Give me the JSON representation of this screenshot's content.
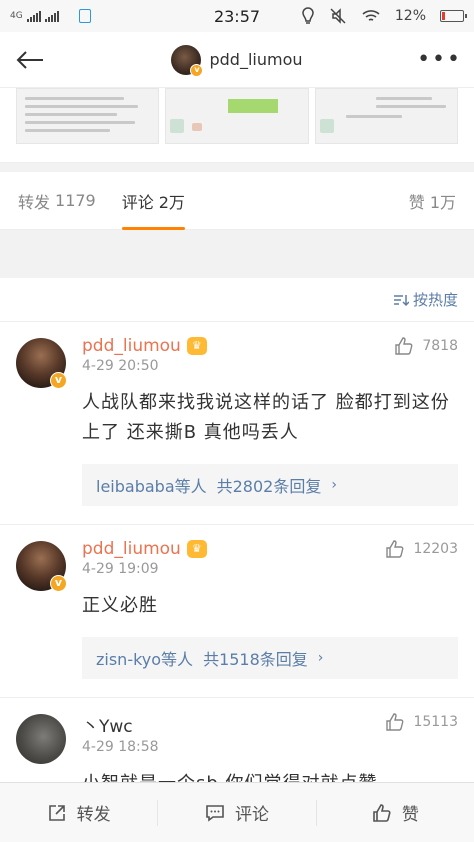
{
  "status_bar": {
    "network": "4G",
    "time": "23:57",
    "battery_percent": "12%"
  },
  "header": {
    "title": "pdd_liumou"
  },
  "tabs": [
    {
      "label": "转发",
      "count": "1179"
    },
    {
      "label": "评论",
      "count": "2万"
    },
    {
      "label": "赞",
      "count": "1万"
    }
  ],
  "sort_label": "按热度",
  "comments": [
    {
      "name": "pdd_liumou",
      "time": "4-29 20:50",
      "likes": "7818",
      "text": "人战队都来找我说这样的话了 脸都打到这份上了 还来撕B 真他吗丢人",
      "replies": {
        "users": "leibababa等人",
        "count": "共2802条回复"
      }
    },
    {
      "name": "pdd_liumou",
      "time": "4-29 19:09",
      "likes": "12203",
      "text": "正义必胜",
      "replies": {
        "users": "zisn-kyo等人",
        "count": "共1518条回复"
      }
    },
    {
      "name": "丶Ywc",
      "time": "4-29 18:58",
      "likes": "15113",
      "text": "小智就是一个sb 你们觉得对就点赞"
    }
  ],
  "bottom_bar": {
    "repost": "转发",
    "comment": "评论",
    "like": "赞"
  }
}
